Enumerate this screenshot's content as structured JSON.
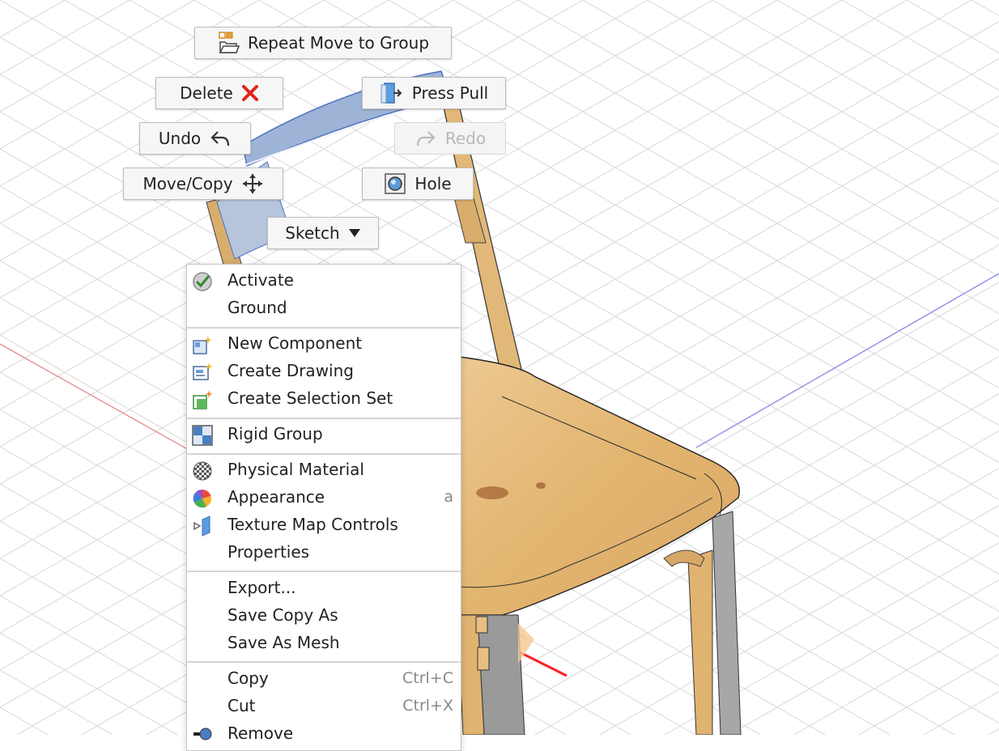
{
  "marking_menu": {
    "repeat": "Repeat Move to Group",
    "delete": "Delete",
    "press_pull": "Press Pull",
    "undo": "Undo",
    "redo": "Redo",
    "move_copy": "Move/Copy",
    "hole": "Hole",
    "sketch": "Sketch"
  },
  "context_menu": {
    "activate": "Activate",
    "ground": "Ground",
    "new_component": "New Component",
    "create_drawing": "Create Drawing",
    "create_selection_set": "Create Selection Set",
    "rigid_group": "Rigid Group",
    "physical_material": "Physical Material",
    "appearance": "Appearance",
    "appearance_shortcut": "a",
    "texture_map_controls": "Texture Map Controls",
    "properties": "Properties",
    "export": "Export...",
    "save_copy_as": "Save Copy As",
    "save_as_mesh": "Save As Mesh",
    "copy": "Copy",
    "copy_shortcut": "Ctrl+C",
    "cut": "Cut",
    "cut_shortcut": "Ctrl+X",
    "remove": "Remove"
  },
  "colors": {
    "x_axis": "#e85b5b",
    "z_axis": "#7a7ae0",
    "wood": "#e2b878",
    "selection_blue": "#7fa2d6",
    "delete_red": "#e0241b"
  }
}
